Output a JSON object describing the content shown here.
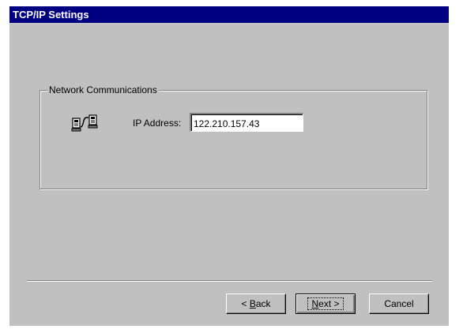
{
  "window": {
    "title": "TCP/IP Settings"
  },
  "network_group": {
    "label": "Network Communications",
    "icon": "network-connection-icon",
    "ip_label": "IP Address:",
    "ip_value": "122.210.157.43"
  },
  "buttons": {
    "back": {
      "prefix": "< ",
      "mnemonic": "B",
      "rest": "ack"
    },
    "next": {
      "mnemonic": "N",
      "rest": "ext >"
    },
    "cancel": "Cancel"
  },
  "colors": {
    "title_bar": "#000080",
    "dialog_face": "#c0c0c0"
  }
}
